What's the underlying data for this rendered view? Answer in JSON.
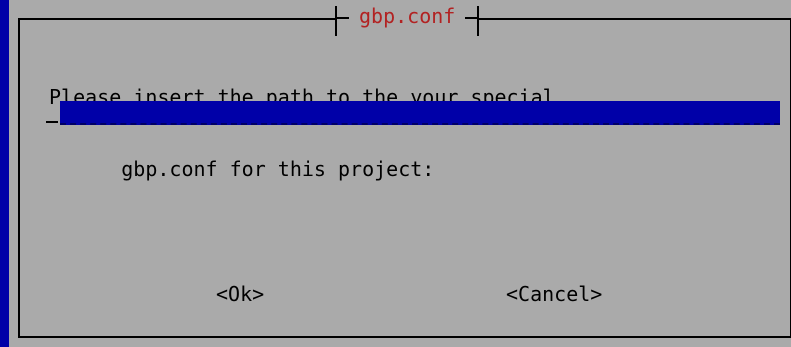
{
  "dialog": {
    "title": "gbp.conf",
    "prompt_line1": "Please insert the path to the your special",
    "prompt_line2": "      gbp.conf for this project:",
    "input_value": "",
    "buttons": {
      "ok_label": "<Ok>",
      "cancel_label": "<Cancel>"
    }
  },
  "colors": {
    "background": "#0000a8",
    "dialog": "#aaaaaa",
    "title": "#b22222",
    "input": "#0000a8"
  }
}
